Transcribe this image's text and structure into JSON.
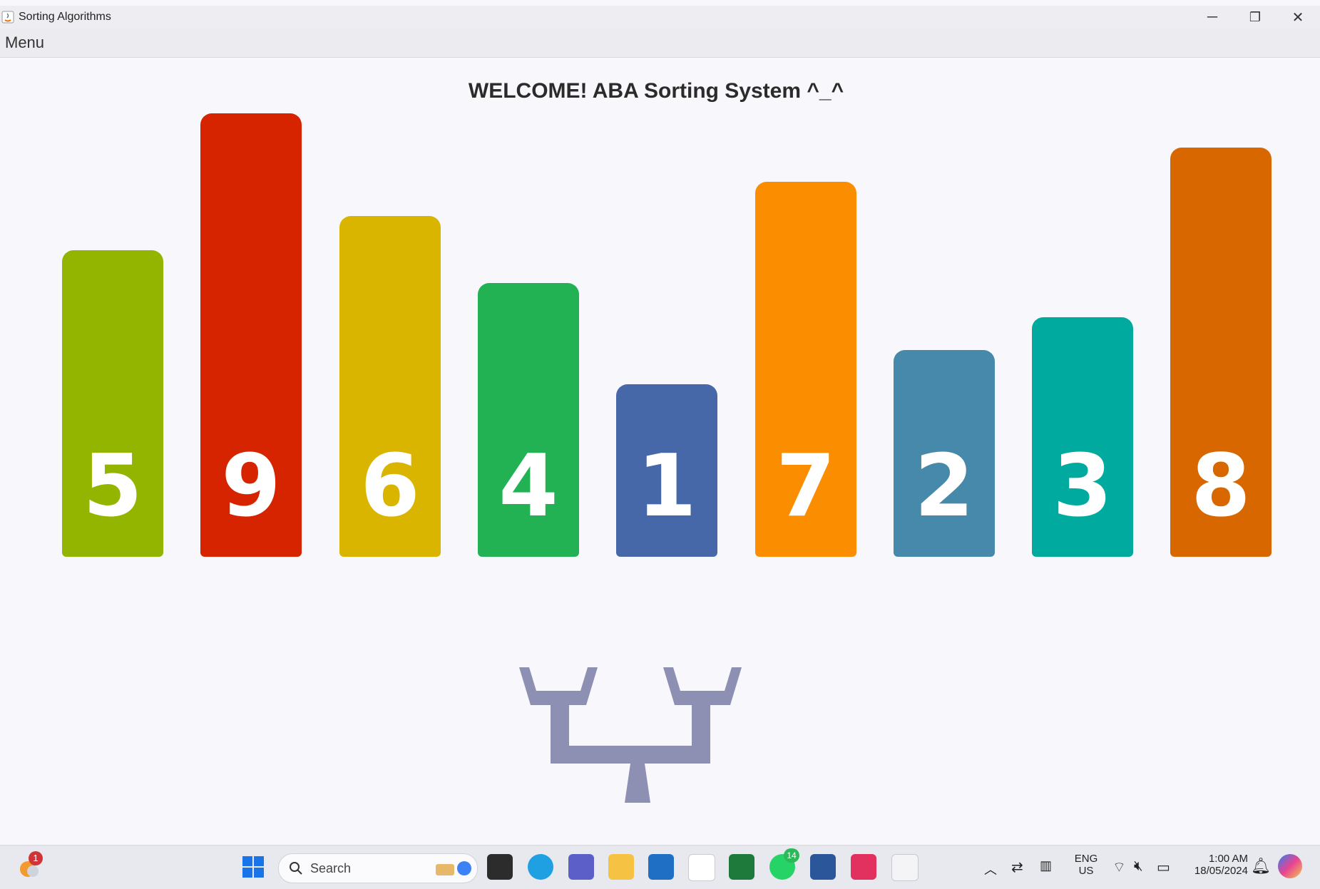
{
  "window": {
    "title": "Sorting Algorithms",
    "minimize": "─",
    "maximize": "❐",
    "close": "✕"
  },
  "menubar": {
    "menu_label": "Menu"
  },
  "main": {
    "welcome": "WELCOME! ABA Sorting System  ^_^",
    "bars": [
      {
        "value": "5",
        "color": "#93b500"
      },
      {
        "value": "9",
        "color": "#d62400"
      },
      {
        "value": "6",
        "color": "#d9b500"
      },
      {
        "value": "4",
        "color": "#22b254"
      },
      {
        "value": "1",
        "color": "#4668a8"
      },
      {
        "value": "7",
        "color": "#fb8d00"
      },
      {
        "value": "2",
        "color": "#4689aa"
      },
      {
        "value": "3",
        "color": "#00aa9f"
      },
      {
        "value": "8",
        "color": "#d86700"
      }
    ]
  },
  "taskbar": {
    "weather_badge": "1",
    "search_placeholder": "Search",
    "whatsapp_badge": "14",
    "lang_top": "ENG",
    "lang_bottom": "US",
    "time": "1:00 AM",
    "date": "18/05/2024"
  }
}
